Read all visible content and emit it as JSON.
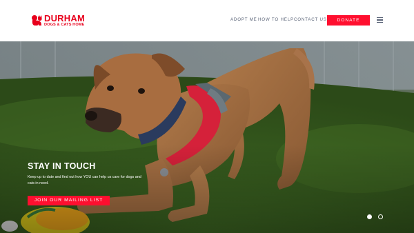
{
  "brand": {
    "name_line1": "DURHAM",
    "name_line2": "DOGS & CATS HOME",
    "color": "#e8001c"
  },
  "nav": {
    "items": [
      {
        "label": "ADOPT ME"
      },
      {
        "label": "HOW TO HELP"
      },
      {
        "label": "CONTACT US"
      }
    ],
    "donate_label": "DONATE",
    "menu_icon": "hamburger-icon"
  },
  "hero": {
    "title": "STAY IN TOUCH",
    "text": "Keep up to date and find out how YOU can help us care for dogs and cats in need.",
    "cta_label": "JOIN OUR MAILING LIST",
    "accent_color": "#ff0f2f",
    "carousel": {
      "slides": 2,
      "active": 1
    }
  }
}
